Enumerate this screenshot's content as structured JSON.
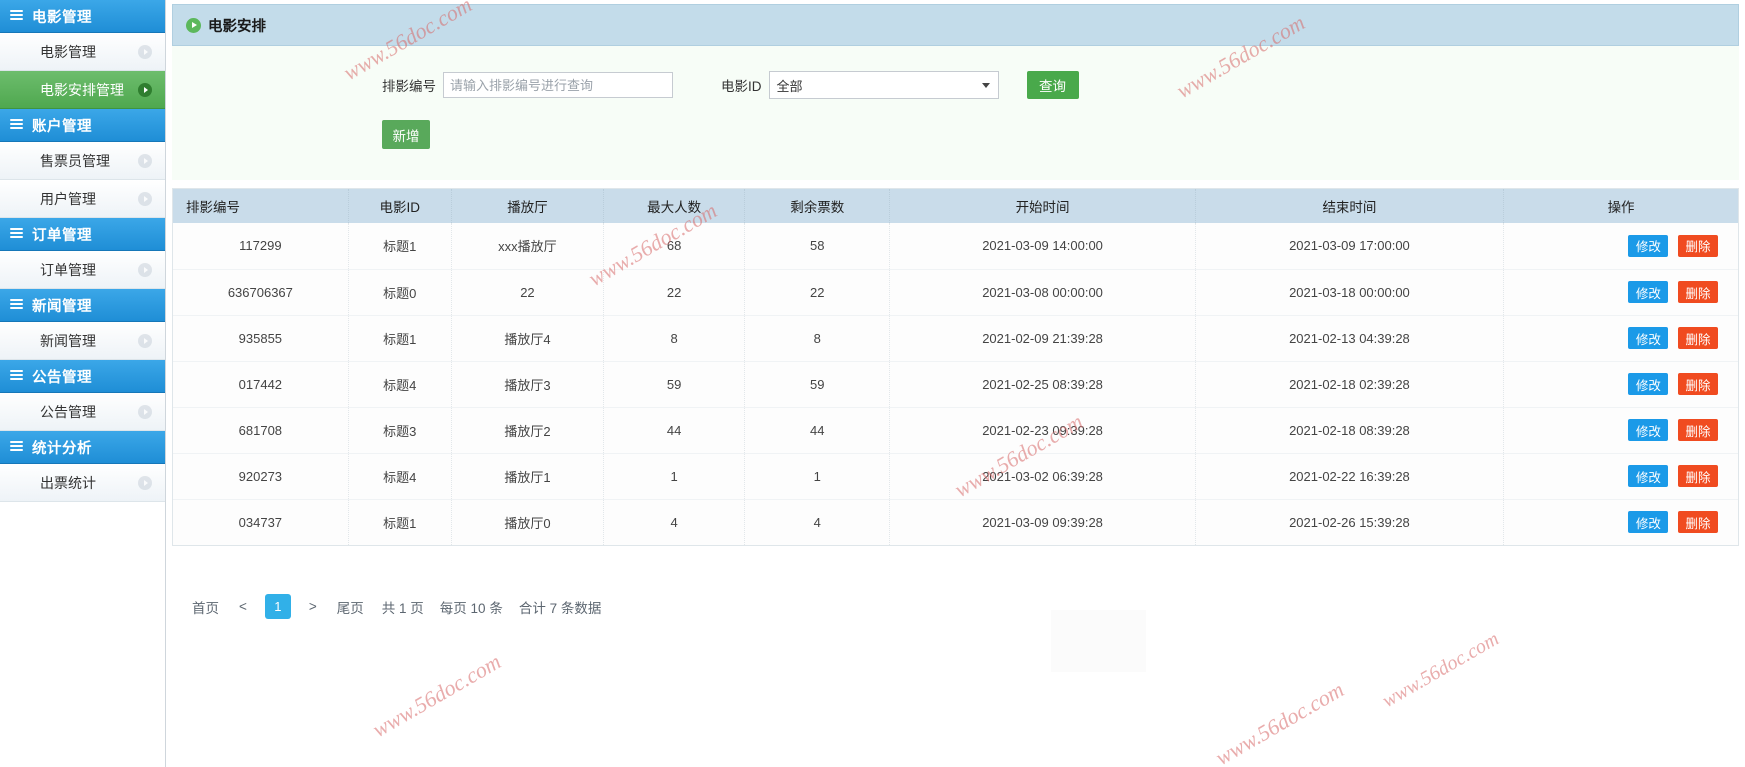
{
  "sidebar": {
    "groups": [
      {
        "label": "电影管理",
        "icon": "list-icon",
        "items": [
          {
            "label": "电影管理",
            "active": false
          },
          {
            "label": "电影安排管理",
            "active": true
          }
        ]
      },
      {
        "label": "账户管理",
        "icon": "list-icon",
        "items": [
          {
            "label": "售票员管理",
            "active": false
          },
          {
            "label": "用户管理",
            "active": false
          }
        ]
      },
      {
        "label": "订单管理",
        "icon": "list-icon",
        "items": [
          {
            "label": "订单管理",
            "active": false
          }
        ]
      },
      {
        "label": "新闻管理",
        "icon": "list-icon",
        "items": [
          {
            "label": "新闻管理",
            "active": false
          }
        ]
      },
      {
        "label": "公告管理",
        "icon": "list-icon",
        "items": [
          {
            "label": "公告管理",
            "active": false
          }
        ]
      },
      {
        "label": "统计分析",
        "icon": "list-icon",
        "items": [
          {
            "label": "出票统计",
            "active": false
          }
        ]
      }
    ]
  },
  "header": {
    "title": "电影安排",
    "icon": "play-circle-icon"
  },
  "search": {
    "code_label": "排影编号",
    "code_value": "",
    "code_placeholder": "请输入排影编号进行查询",
    "movie_label": "电影ID",
    "movie_selected": "全部",
    "movie_options": [
      "全部"
    ],
    "query_label": "查询",
    "add_label": "新增"
  },
  "table": {
    "columns": [
      "排影编号",
      "电影ID",
      "播放厅",
      "最大人数",
      "剩余票数",
      "开始时间",
      "结束时间",
      "操作"
    ],
    "rows": [
      {
        "code": "117299",
        "movie": "标题1",
        "hall": "xxx播放厅",
        "max": "68",
        "left": "58",
        "start": "2021-03-09 14:00:00",
        "end": "2021-03-09 17:00:00",
        "edit": "修改",
        "delete": "删除"
      },
      {
        "code": "636706367",
        "movie": "标题0",
        "hall": "22",
        "max": "22",
        "left": "22",
        "start": "2021-03-08 00:00:00",
        "end": "2021-03-18 00:00:00",
        "edit": "修改",
        "delete": "删除"
      },
      {
        "code": "935855",
        "movie": "标题1",
        "hall": "播放厅4",
        "max": "8",
        "left": "8",
        "start": "2021-02-09 21:39:28",
        "end": "2021-02-13 04:39:28",
        "edit": "修改",
        "delete": "删除"
      },
      {
        "code": "017442",
        "movie": "标题4",
        "hall": "播放厅3",
        "max": "59",
        "left": "59",
        "start": "2021-02-25 08:39:28",
        "end": "2021-02-18 02:39:28",
        "edit": "修改",
        "delete": "删除"
      },
      {
        "code": "681708",
        "movie": "标题3",
        "hall": "播放厅2",
        "max": "44",
        "left": "44",
        "start": "2021-02-23 09:39:28",
        "end": "2021-02-18 08:39:28",
        "edit": "修改",
        "delete": "删除"
      },
      {
        "code": "920273",
        "movie": "标题4",
        "hall": "播放厅1",
        "max": "1",
        "left": "1",
        "start": "2021-03-02 06:39:28",
        "end": "2021-02-22 16:39:28",
        "edit": "修改",
        "delete": "删除"
      },
      {
        "code": "034737",
        "movie": "标题1",
        "hall": "播放厅0",
        "max": "4",
        "left": "4",
        "start": "2021-03-09 09:39:28",
        "end": "2021-02-26 15:39:28",
        "edit": "修改",
        "delete": "删除"
      }
    ]
  },
  "pagination": {
    "first": "首页",
    "prev": "<",
    "current": "1",
    "next": ">",
    "last": "尾页",
    "total_pages": "共 1 页",
    "page_size": "每页 10 条",
    "total_records": "合计 7 条数据"
  },
  "watermarks": [
    {
      "text": "www.56doc.com"
    },
    {
      "text": "www.56doc.com"
    },
    {
      "text": "www.56doc.com"
    },
    {
      "text": "www.56doc.com"
    },
    {
      "text": "www.56doc.com"
    },
    {
      "text": "www.56doc.com"
    },
    {
      "text": "www.56doc.com"
    }
  ],
  "colors": {
    "sidebar_group": "#2a93d9",
    "sidebar_active": "#5bb35b",
    "header_bg": "#c3dcea",
    "btn_green": "#49a94b",
    "btn_edit": "#1b9ae8",
    "btn_delete": "#f04b20",
    "pager_active": "#31b0e8",
    "watermark": "#d86a6a"
  }
}
